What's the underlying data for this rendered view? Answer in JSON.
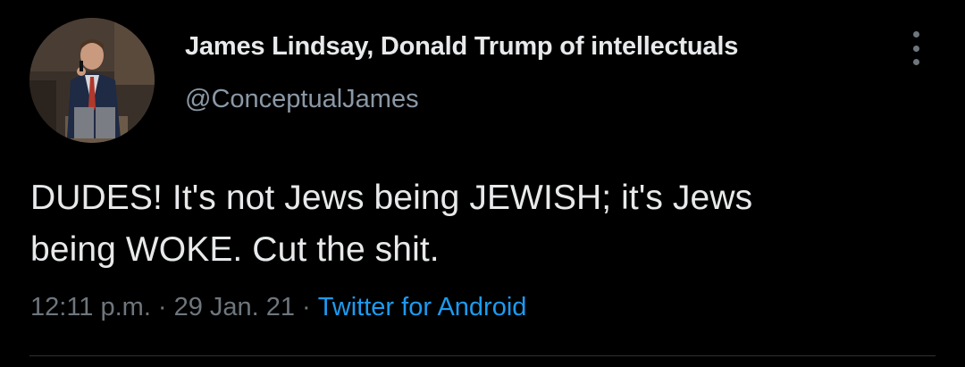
{
  "author": {
    "display_name": "James Lindsay, Donald Trump of intellectuals",
    "handle": "@ConceptualJames",
    "avatar_icon": "profile-photo"
  },
  "tweet": {
    "line1": "DUDES! It's not Jews being JEWISH; it's Jews",
    "line2": "being WOKE. Cut the shit."
  },
  "meta": {
    "time": "12:11 p.m.",
    "separator": "·",
    "date": "29 Jan. 21",
    "source": "Twitter for Android"
  },
  "colors": {
    "background": "#000000",
    "text": "#e7e9ea",
    "secondary_text": "#8b98a5",
    "link": "#1d9bf0",
    "divider": "#2f3336"
  },
  "icons": {
    "more": "vertical-ellipsis-icon"
  }
}
